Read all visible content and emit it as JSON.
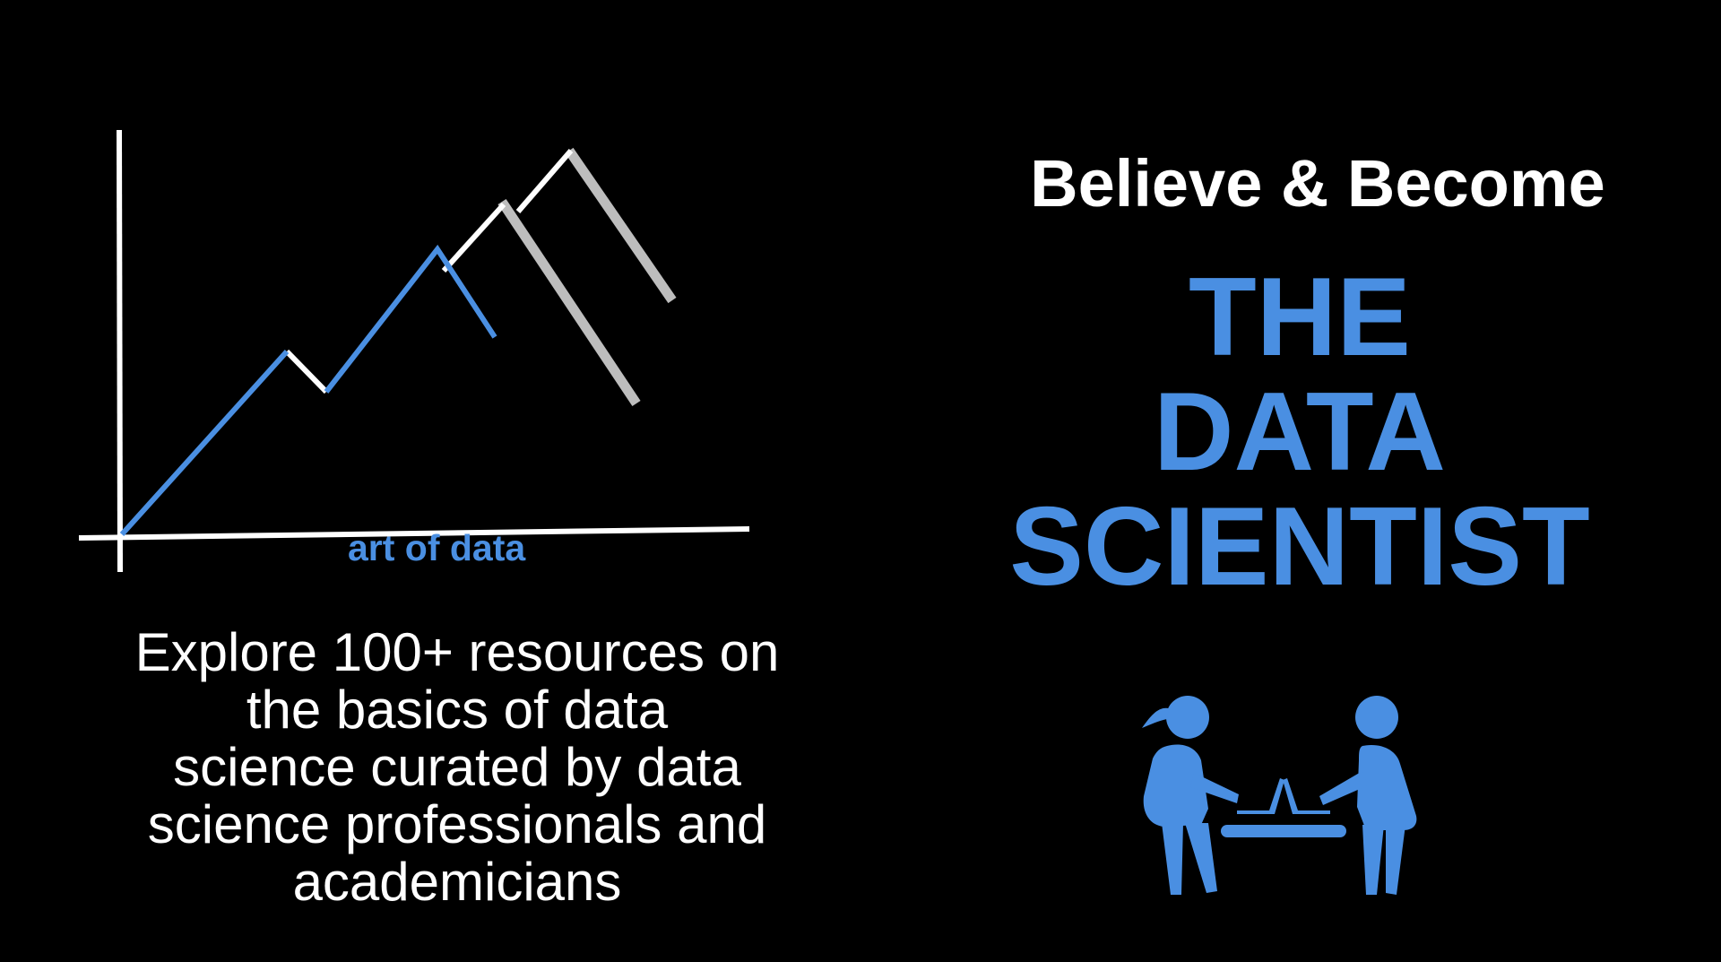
{
  "colors": {
    "background": "#000000",
    "accent_blue": "#4a8fe2",
    "white": "#ffffff",
    "gray": "#bdbdbd"
  },
  "logo": {
    "wordmark": "art of data",
    "icon": "line-chart-icon"
  },
  "tagline": {
    "lines": [
      "Explore 100+ resources on",
      "the basics of data",
      "science curated by data",
      "science professionals and",
      "academicians"
    ]
  },
  "headline": "Believe & Become",
  "title": {
    "lines": [
      "THE",
      "DATA",
      "SCIENTIST"
    ]
  },
  "illustration": {
    "icon": "two-people-with-laptops-icon"
  }
}
